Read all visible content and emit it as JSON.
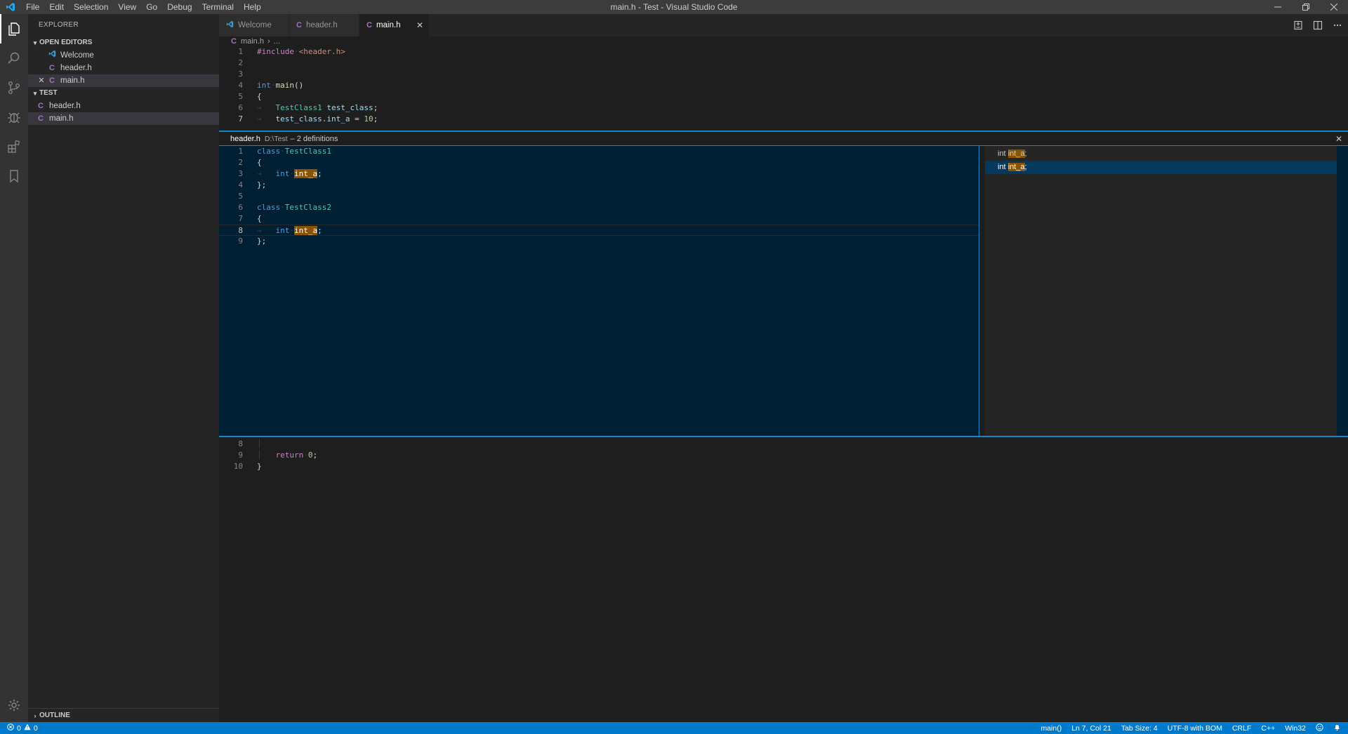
{
  "window": {
    "title": "main.h - Test - Visual Studio Code"
  },
  "menu": [
    "File",
    "Edit",
    "Selection",
    "View",
    "Go",
    "Debug",
    "Terminal",
    "Help"
  ],
  "sidebar": {
    "title": "EXPLORER",
    "open_editors_label": "OPEN EDITORS",
    "open_editors": [
      {
        "label": "Welcome",
        "icon": "vscode-icon"
      },
      {
        "label": "header.h",
        "icon": "c-file-icon"
      },
      {
        "label": "main.h",
        "icon": "c-file-icon"
      }
    ],
    "folder_label": "TEST",
    "files": [
      {
        "label": "header.h"
      },
      {
        "label": "main.h"
      }
    ],
    "outline_label": "OUTLINE",
    "c_glyph": "C"
  },
  "tabs": [
    {
      "label": "Welcome"
    },
    {
      "label": "header.h"
    },
    {
      "label": "main.h"
    }
  ],
  "breadcrumb": {
    "file": "main.h",
    "sep": "›",
    "rest": "..."
  },
  "peek": {
    "file": "header.h",
    "path": "D:\\Test",
    "meta": "– 2 definitions",
    "references": [
      "int int_a;",
      "int int_a;"
    ]
  },
  "code_main_top": [
    {
      "n": "1",
      "text": "#include <header.h>"
    },
    {
      "n": "2",
      "text": ""
    },
    {
      "n": "3",
      "text": ""
    },
    {
      "n": "4",
      "text": "int main()"
    },
    {
      "n": "5",
      "text": "{"
    },
    {
      "n": "6",
      "text": "    TestClass1 test_class;"
    },
    {
      "n": "7",
      "text": "    test_class.int_a = 10;"
    }
  ],
  "code_peek": [
    {
      "n": "1",
      "text": "class TestClass1"
    },
    {
      "n": "2",
      "text": "{"
    },
    {
      "n": "3",
      "text": "    int int_a;"
    },
    {
      "n": "4",
      "text": "};"
    },
    {
      "n": "5",
      "text": ""
    },
    {
      "n": "6",
      "text": "class TestClass2"
    },
    {
      "n": "7",
      "text": "{"
    },
    {
      "n": "8",
      "text": "    int int_a;"
    },
    {
      "n": "9",
      "text": "};"
    }
  ],
  "code_main_bottom": [
    {
      "n": "8",
      "text": ""
    },
    {
      "n": "9",
      "text": "    return 0;"
    },
    {
      "n": "10",
      "text": "}"
    }
  ],
  "status": {
    "errors": "0",
    "warnings": "0",
    "scope": "main()",
    "position": "Ln 7, Col 21",
    "tab_size": "Tab Size: 4",
    "encoding": "UTF-8 with BOM",
    "eol": "CRLF",
    "language": "C++",
    "platform": "Win32"
  },
  "colors": {
    "accent": "#007acc",
    "peek_border": "#1a85c6",
    "highlight": "#8a5300",
    "c_icon": "#a074c4"
  }
}
